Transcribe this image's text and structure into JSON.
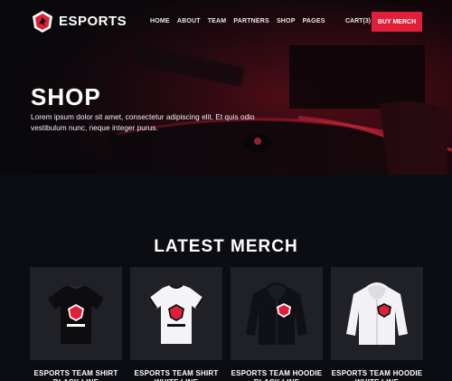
{
  "nav": {
    "brand": "ESPORTS",
    "menu": [
      "HOME",
      "ABOUT",
      "TEAM",
      "PARTNERS",
      "SHOP",
      "PAGES"
    ],
    "cart_label": "CART(3)",
    "cta_label": "BUY MERCH"
  },
  "hero": {
    "title": "SHOP",
    "text": "Lorem ipsum dolor sit amet, consectetur adipiscing elit. Et quis odio vestibulum nunc, neque integer purus."
  },
  "section": {
    "title": "LATEST MERCH"
  },
  "products": [
    {
      "name": "ESPORTS TEAM SHIRT BLACK LINE",
      "icon": "tshirt-black-icon"
    },
    {
      "name": "ESPORTS TEAM SHIRT WHITE LINE",
      "icon": "tshirt-white-icon"
    },
    {
      "name": "ESPORTS TEAM HOODIE BLACK LINE",
      "icon": "hoodie-black-icon"
    },
    {
      "name": "ESPORTS TEAM HOODIE WHITE LINE",
      "icon": "hoodie-white-icon"
    }
  ],
  "colors": {
    "accent": "#e0203a",
    "background": "#0c0d12",
    "card": "#1f2127"
  }
}
